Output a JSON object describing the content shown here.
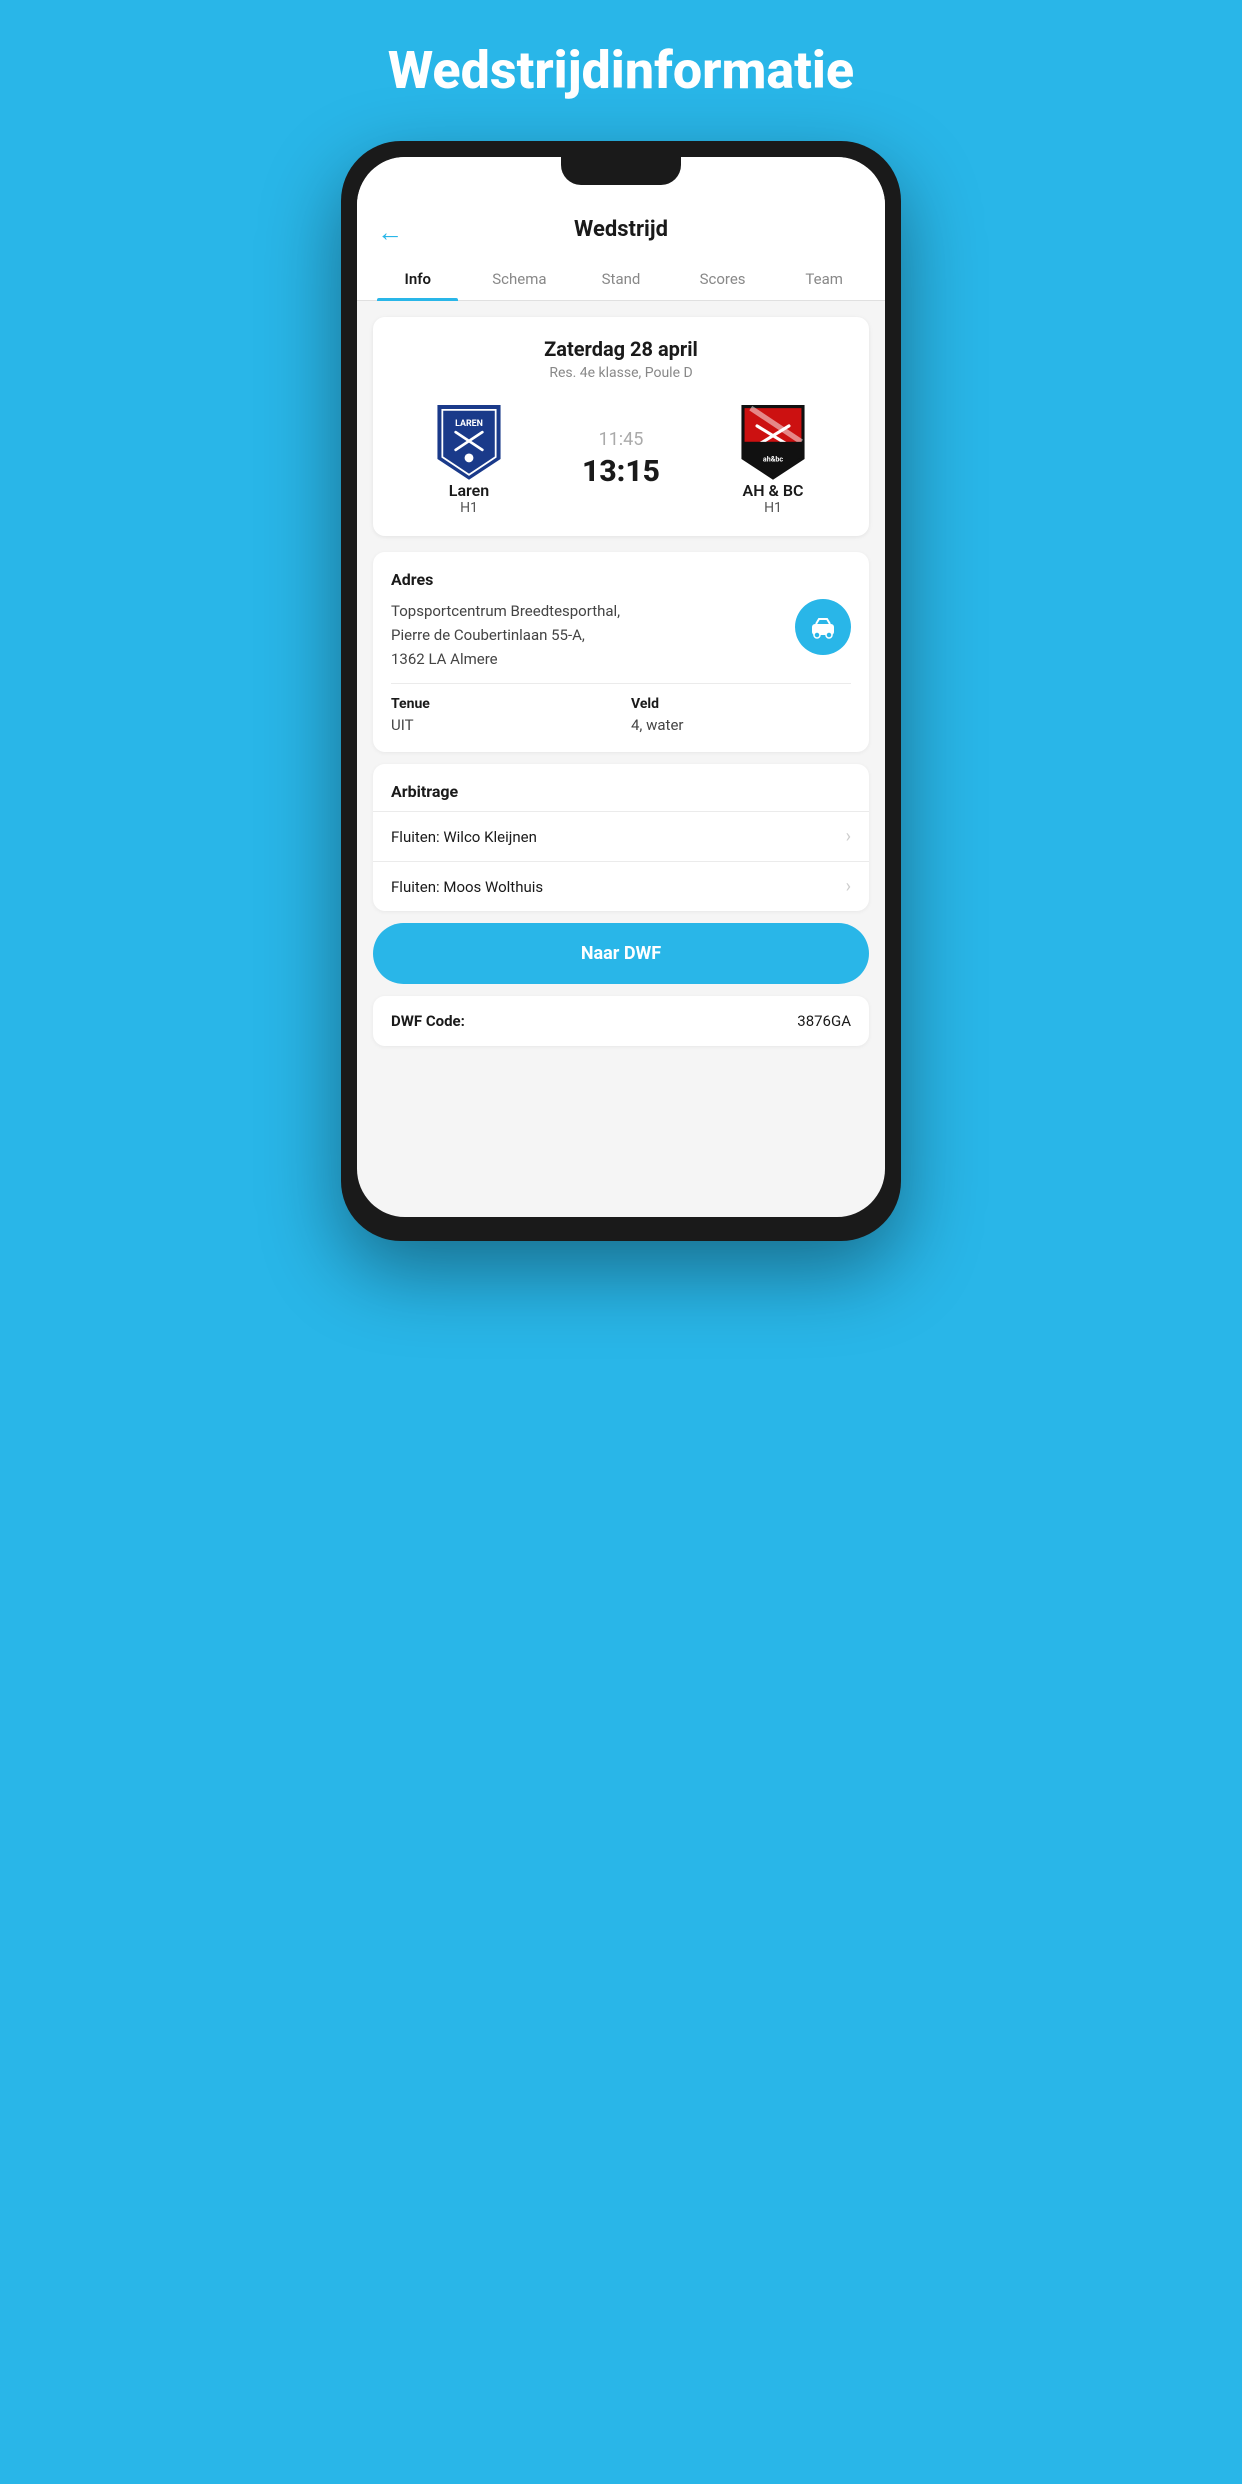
{
  "page": {
    "background_title": "Wedstrijdinformatie"
  },
  "header": {
    "title": "Wedstrijd",
    "back_label": "←"
  },
  "tabs": [
    {
      "id": "info",
      "label": "Info",
      "active": true
    },
    {
      "id": "schema",
      "label": "Schema",
      "active": false
    },
    {
      "id": "stand",
      "label": "Stand",
      "active": false
    },
    {
      "id": "scores",
      "label": "Scores",
      "active": false
    },
    {
      "id": "team",
      "label": "Team",
      "active": false
    }
  ],
  "match": {
    "date": "Zaterdag 28 april",
    "league": "Res. 4e klasse, Poule D",
    "home_team": {
      "name": "Laren",
      "sub": "H1"
    },
    "away_team": {
      "name": "AH & BC",
      "sub": "H1"
    },
    "score_time": "11:45",
    "score_main": "13:15"
  },
  "address": {
    "label": "Adres",
    "text_line1": "Topsportcentrum Breedtesporthal,",
    "text_line2": "Pierre de Coubertinlaan 55-A,",
    "text_line3": "1362 LA Almere"
  },
  "tenue": {
    "label": "Tenue",
    "value": "UIT"
  },
  "veld": {
    "label": "Veld",
    "value": "4, water"
  },
  "arbitrage": {
    "label": "Arbitrage",
    "items": [
      {
        "name": "Fluiten: Wilco Kleijnen"
      },
      {
        "name": "Fluiten: Moos Wolthuis"
      }
    ]
  },
  "dwf_button": {
    "label": "Naar DWF"
  },
  "dwf_code": {
    "label": "DWF Code:",
    "value": "3876GA"
  },
  "colors": {
    "primary": "#29b6e8",
    "background": "#29b6e8"
  }
}
